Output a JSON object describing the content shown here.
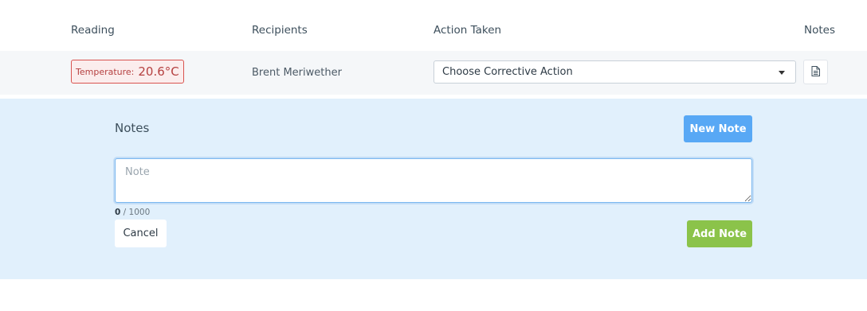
{
  "columns": {
    "reading": "Reading",
    "recipients": "Recipients",
    "action_taken": "Action Taken",
    "notes": "Notes"
  },
  "row": {
    "reading_label": "Temperature:",
    "reading_value": "20.6°C",
    "recipient": "Brent Meriwether",
    "action_select": "Choose Corrective Action"
  },
  "notes_panel": {
    "title": "Notes",
    "new_note_label": "New Note",
    "note_placeholder": "Note",
    "note_value": "",
    "char_count": "0",
    "char_limit": "/ 1000",
    "cancel_label": "Cancel",
    "add_note_label": "Add Note"
  },
  "icons": {
    "notes_icon": "document-icon",
    "select_caret": "chevron-down-icon"
  },
  "colors": {
    "alert_border": "#d9534f",
    "primary": "#58a8f5",
    "success": "#8bc34a",
    "panel_bg": "#e1f0fc"
  }
}
